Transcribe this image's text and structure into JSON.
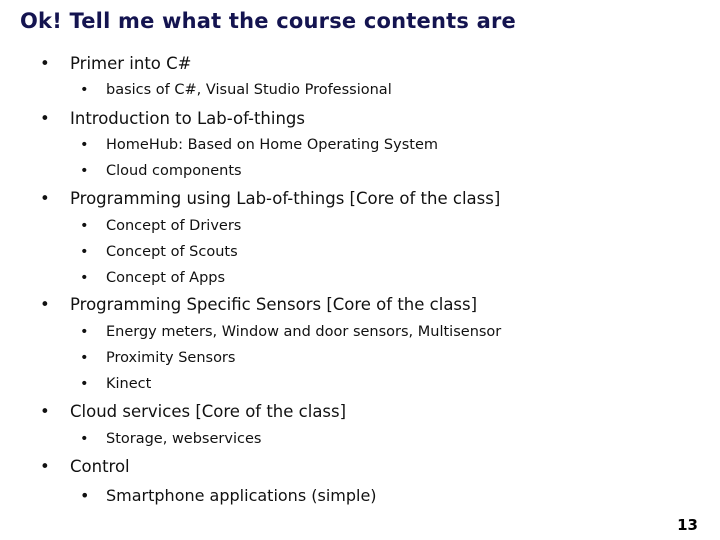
{
  "slide": {
    "title": "Ok! Tell me what the course contents are",
    "bullet_glyph": "•",
    "page_number": "13",
    "items": [
      {
        "text": "Primer into C#",
        "subitems": [
          "basics of C#, Visual Studio Professional"
        ]
      },
      {
        "text": "Introduction to Lab-of-things",
        "subitems": [
          "HomeHub: Based on Home Operating System",
          "Cloud components"
        ]
      },
      {
        "text": "Programming using Lab-of-things [Core of the class]",
        "subitems": [
          "Concept of Drivers",
          "Concept of Scouts",
          "Concept of Apps"
        ]
      },
      {
        "text": "Programming Specific Sensors [Core of the class]",
        "subitems": [
          "Energy meters, Window and door sensors, Multisensor",
          "Proximity Sensors",
          "Kinect"
        ]
      },
      {
        "text": "Cloud services [Core of the class]",
        "subitems": [
          "Storage, webservices"
        ]
      },
      {
        "text": "Control",
        "subitems": [
          "Smartphone applications (simple)"
        ]
      }
    ]
  }
}
